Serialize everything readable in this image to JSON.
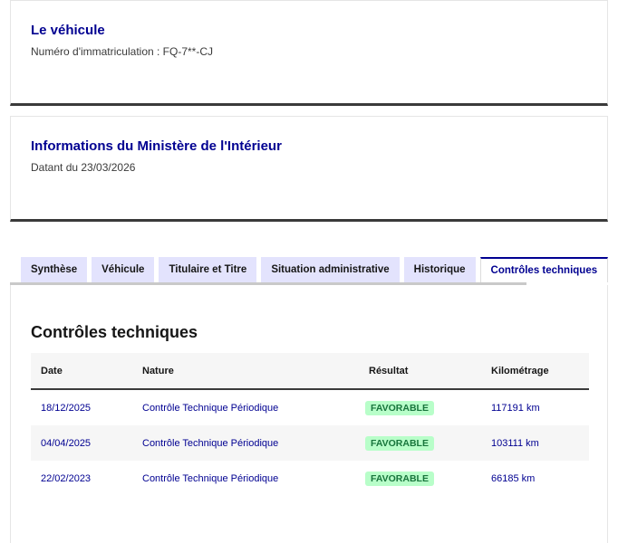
{
  "vehicule": {
    "title": "Le véhicule",
    "immatriculation": "Numéro d'immatriculation : FQ-7**-CJ"
  },
  "ministere": {
    "title": "Informations du Ministère de l'Intérieur",
    "date": "Datant du 23/03/2026"
  },
  "tabs": [
    {
      "label": "Synthèse"
    },
    {
      "label": "Véhicule"
    },
    {
      "label": "Titulaire et Titre"
    },
    {
      "label": "Situation administrative"
    },
    {
      "label": "Historique"
    },
    {
      "label": "Contrôles techniques"
    }
  ],
  "active_tab": "Contrôles techniques",
  "controles": {
    "title": "Contrôles techniques",
    "columns": [
      "Date",
      "Nature",
      "Résultat",
      "Kilométrage"
    ],
    "rows": [
      {
        "date": "18/12/2025",
        "nature": "Contrôle Technique Périodique",
        "resultat": "FAVORABLE",
        "km": "117191 km"
      },
      {
        "date": "04/04/2025",
        "nature": "Contrôle Technique Périodique",
        "resultat": "FAVORABLE",
        "km": "103111 km"
      },
      {
        "date": "22/02/2023",
        "nature": "Contrôle Technique Périodique",
        "resultat": "FAVORABLE",
        "km": "66185 km"
      }
    ]
  },
  "colors": {
    "accent": "#000091",
    "tab_bg": "#e3e3fd",
    "badge_bg": "#b8fec9",
    "badge_text": "#18753c"
  }
}
